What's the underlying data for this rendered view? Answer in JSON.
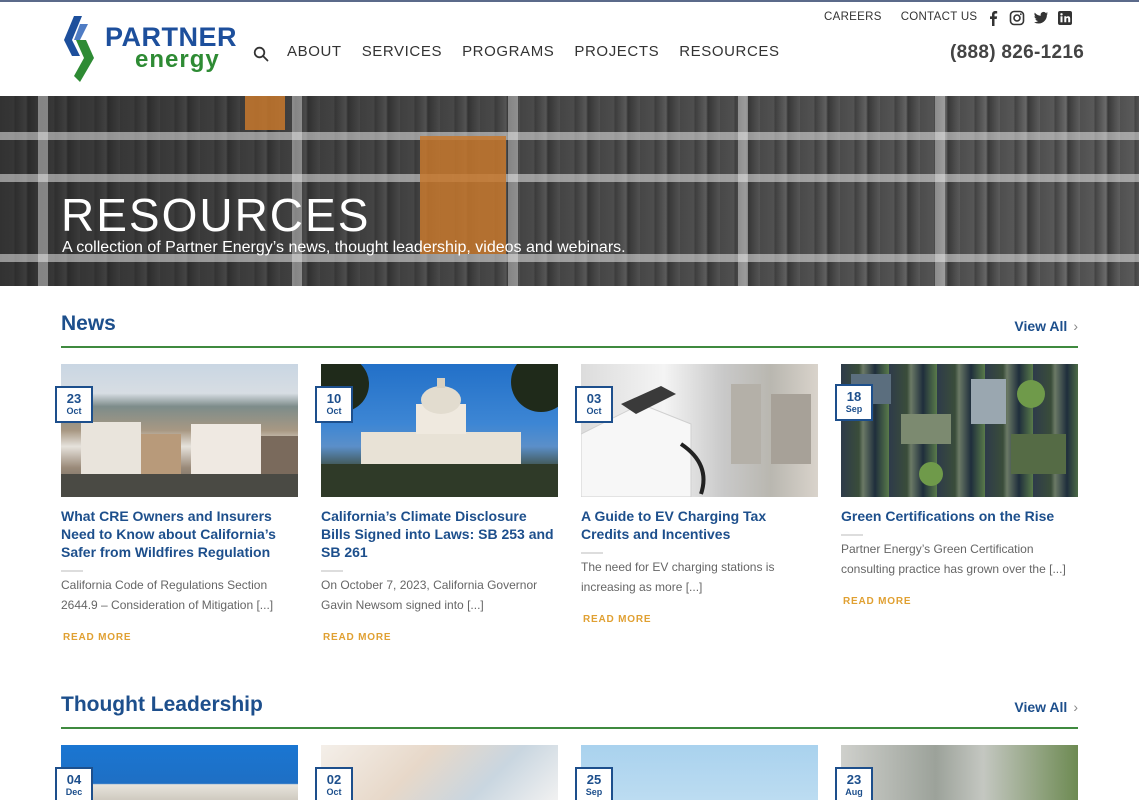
{
  "brand": {
    "name_line1": "PARTNER",
    "name_line2": "energy",
    "colors": {
      "blue": "#1d4f9c",
      "green": "#2e8b34",
      "accent": "#e0a032"
    }
  },
  "header": {
    "nav": [
      {
        "label": "ABOUT"
      },
      {
        "label": "SERVICES"
      },
      {
        "label": "PROGRAMS"
      },
      {
        "label": "PROJECTS"
      },
      {
        "label": "RESOURCES"
      }
    ],
    "top_links": [
      {
        "label": "CAREERS"
      },
      {
        "label": "CONTACT US"
      }
    ],
    "social_icons": [
      "facebook-icon",
      "instagram-icon",
      "twitter-icon",
      "linkedin-icon"
    ],
    "phone": "(888) 826-1216",
    "search_icon": "search-icon"
  },
  "hero": {
    "title": "RESOURCES",
    "subtitle": "A collection of Partner Energy’s news, thought leadership, videos and webinars."
  },
  "news": {
    "title": "News",
    "view_all": "View All",
    "cards": [
      {
        "day": "23",
        "month": "Oct",
        "title": "What CRE Owners and Insurers Need to Know about California’s Safer from Wildfires Regulation",
        "excerpt": "California Code of Regulations Section 2644.9 – Consideration of Mitigation [...]",
        "read_more": "READ MORE"
      },
      {
        "day": "10",
        "month": "Oct",
        "title": "California’s Climate Disclosure Bills Signed into Laws: SB 253 and SB 261",
        "excerpt": "On October 7, 2023, California Governor Gavin Newsom signed into [...]",
        "read_more": "READ MORE"
      },
      {
        "day": "03",
        "month": "Oct",
        "title": "A Guide to EV Charging Tax Credits and Incentives",
        "excerpt": "The need for EV charging stations is increasing as more [...]",
        "read_more": "READ MORE"
      },
      {
        "day": "18",
        "month": "Sep",
        "title": "Green Certifications on the Rise",
        "excerpt": "Partner Energy’s Green Certification consulting practice has grown over the [...]",
        "read_more": "READ MORE"
      }
    ]
  },
  "thought_leadership": {
    "title": "Thought Leadership",
    "view_all": "View All",
    "cards": [
      {
        "day": "04",
        "month": "Dec"
      },
      {
        "day": "02",
        "month": "Oct"
      },
      {
        "day": "25",
        "month": "Sep"
      },
      {
        "day": "23",
        "month": "Aug"
      }
    ]
  }
}
